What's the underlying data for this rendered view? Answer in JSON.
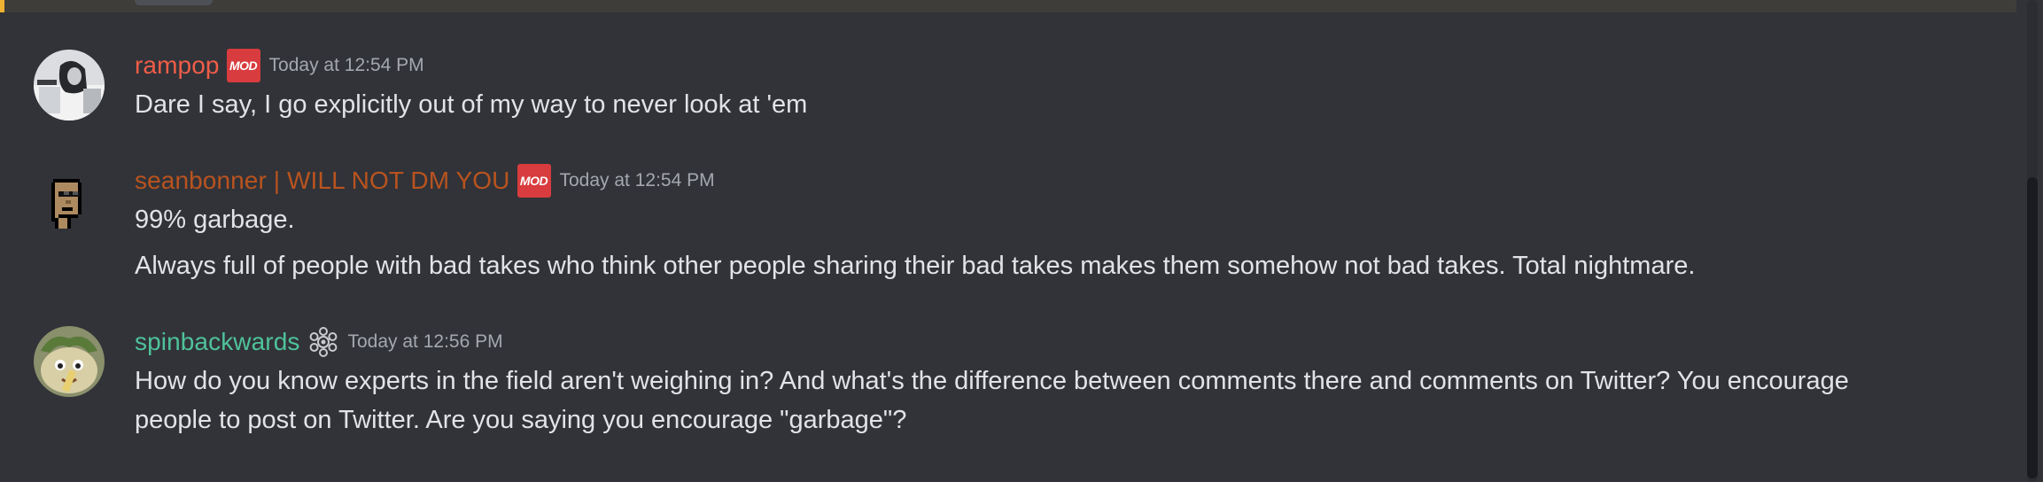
{
  "messages": [
    {
      "username": "rampop",
      "username_color": "#f05d48",
      "badge": "MOD",
      "timestamp": "Today at 12:54 PM",
      "lines": [
        "Dare I say, I go explicitly out of my way to never look at 'em"
      ]
    },
    {
      "username": "seanbonner | WILL NOT DM YOU",
      "username_color": "#b9531f",
      "badge": "MOD",
      "timestamp": "Today at 12:54 PM",
      "lines": [
        "99% garbage.",
        "Always full of people with bad takes who think other people sharing their bad takes makes them somehow not bad takes. Total nightmare."
      ]
    },
    {
      "username": "spinbackwards",
      "username_color": "#4fc29a",
      "badge_icon": "gear-badge-icon",
      "timestamp": "Today at 12:56 PM",
      "lines": [
        "How do you know experts in the field aren't weighing in? And what's the difference between comments there and comments on Twitter? You encourage people to post on Twitter. Are you saying you encourage \"garbage\"?"
      ]
    }
  ]
}
